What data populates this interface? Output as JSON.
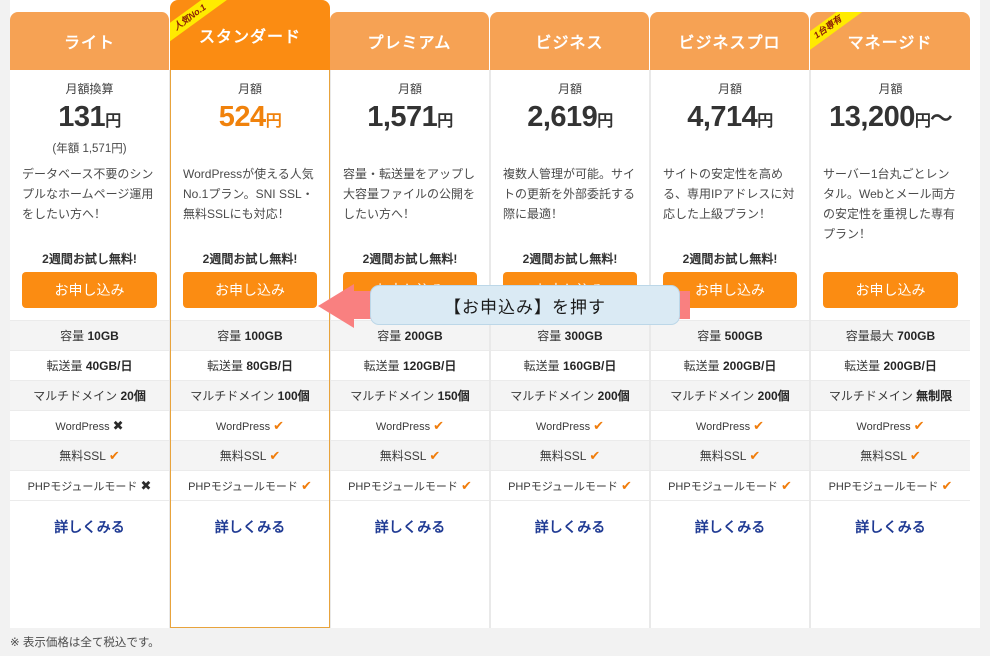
{
  "footnote": "※ 表示価格は全て税込です。",
  "annotation": {
    "text": "【お申込み】を押す",
    "arrow_color": "#f98080",
    "pill_color": "#daeaf4"
  },
  "labels": {
    "detail_link": "詳しくみる",
    "apply_button": "お申し込み",
    "trial": "2週間お試し無料!"
  },
  "colors": {
    "tab": "#f6a254",
    "tab_featured": "#fb8c12",
    "ribbon": "#ffeb00",
    "ribbon_text": "#8b1d06",
    "price_featured": "#f0820c",
    "button": "#fb8c12",
    "detail_link": "#1f3a93",
    "check": "#f07c0a",
    "cross": "#2b2b2b"
  },
  "plans": [
    {
      "name": "ライト",
      "badge": null,
      "featured": false,
      "price_label": "月額換算",
      "price_value": "131",
      "price_unit": "円",
      "price_suffix": "",
      "price_sub": "(年額 1,571円)",
      "description": "データベース不要のシンプルなホームページ運用をしたい方へ！",
      "trial": "2週間お試し無料!",
      "apply": "お申し込み",
      "specs": [
        {
          "label": "容量",
          "value": "10GB",
          "mark": null
        },
        {
          "label": "転送量",
          "value": "40GB/日",
          "mark": null
        },
        {
          "label": "マルチドメイン",
          "value": "20個",
          "mark": null
        },
        {
          "label": "WordPress",
          "value": "",
          "mark": "no"
        },
        {
          "label": "無料SSL",
          "value": "",
          "mark": "ok"
        },
        {
          "label": "PHPモジュールモード",
          "value": "",
          "mark": "no"
        }
      ],
      "detail": "詳しくみる"
    },
    {
      "name": "スタンダード",
      "badge": "人気No.1",
      "featured": true,
      "price_label": "月額",
      "price_value": "524",
      "price_unit": "円",
      "price_suffix": "",
      "price_sub": "",
      "description": "WordPressが使える人気No.1プラン。SNI SSL・無料SSLにも対応！",
      "trial": "2週間お試し無料!",
      "apply": "お申し込み",
      "specs": [
        {
          "label": "容量",
          "value": "100GB",
          "mark": null
        },
        {
          "label": "転送量",
          "value": "80GB/日",
          "mark": null
        },
        {
          "label": "マルチドメイン",
          "value": "100個",
          "mark": null
        },
        {
          "label": "WordPress",
          "value": "",
          "mark": "ok"
        },
        {
          "label": "無料SSL",
          "value": "",
          "mark": "ok"
        },
        {
          "label": "PHPモジュールモード",
          "value": "",
          "mark": "ok"
        }
      ],
      "detail": "詳しくみる"
    },
    {
      "name": "プレミアム",
      "badge": null,
      "featured": false,
      "price_label": "月額",
      "price_value": "1,571",
      "price_unit": "円",
      "price_suffix": "",
      "price_sub": "",
      "description": "容量・転送量をアップし大容量ファイルの公開をしたい方へ！",
      "trial": "2週間お試し無料!",
      "apply": "お申し込み",
      "specs": [
        {
          "label": "容量",
          "value": "200GB",
          "mark": null
        },
        {
          "label": "転送量",
          "value": "120GB/日",
          "mark": null
        },
        {
          "label": "マルチドメイン",
          "value": "150個",
          "mark": null
        },
        {
          "label": "WordPress",
          "value": "",
          "mark": "ok"
        },
        {
          "label": "無料SSL",
          "value": "",
          "mark": "ok"
        },
        {
          "label": "PHPモジュールモード",
          "value": "",
          "mark": "ok"
        }
      ],
      "detail": "詳しくみる"
    },
    {
      "name": "ビジネス",
      "badge": null,
      "featured": false,
      "price_label": "月額",
      "price_value": "2,619",
      "price_unit": "円",
      "price_suffix": "",
      "price_sub": "",
      "description": "複数人管理が可能。サイトの更新を外部委託する際に最適！",
      "trial": "2週間お試し無料!",
      "apply": "お申し込み",
      "specs": [
        {
          "label": "容量",
          "value": "300GB",
          "mark": null
        },
        {
          "label": "転送量",
          "value": "160GB/日",
          "mark": null
        },
        {
          "label": "マルチドメイン",
          "value": "200個",
          "mark": null
        },
        {
          "label": "WordPress",
          "value": "",
          "mark": "ok"
        },
        {
          "label": "無料SSL",
          "value": "",
          "mark": "ok"
        },
        {
          "label": "PHPモジュールモード",
          "value": "",
          "mark": "ok"
        }
      ],
      "detail": "詳しくみる"
    },
    {
      "name": "ビジネスプロ",
      "badge": null,
      "featured": false,
      "price_label": "月額",
      "price_value": "4,714",
      "price_unit": "円",
      "price_suffix": "",
      "price_sub": "",
      "description": "サイトの安定性を高める、専用IPアドレスに対応した上級プラン！",
      "trial": "2週間お試し無料!",
      "apply": "お申し込み",
      "specs": [
        {
          "label": "容量",
          "value": "500GB",
          "mark": null
        },
        {
          "label": "転送量",
          "value": "200GB/日",
          "mark": null
        },
        {
          "label": "マルチドメイン",
          "value": "200個",
          "mark": null
        },
        {
          "label": "WordPress",
          "value": "",
          "mark": "ok"
        },
        {
          "label": "無料SSL",
          "value": "",
          "mark": "ok"
        },
        {
          "label": "PHPモジュールモード",
          "value": "",
          "mark": "ok"
        }
      ],
      "detail": "詳しくみる"
    },
    {
      "name": "マネージド",
      "badge": "1台専有",
      "featured": false,
      "price_label": "月額",
      "price_value": "13,200",
      "price_unit": "円",
      "price_suffix": "〜",
      "price_sub": "",
      "description": "サーバー1台丸ごとレンタル。Webとメール両方の安定性を重視した専有プラン！",
      "trial": "",
      "apply": "お申し込み",
      "specs": [
        {
          "label": "容量最大",
          "value": "700GB",
          "mark": null
        },
        {
          "label": "転送量",
          "value": "200GB/日",
          "mark": null
        },
        {
          "label": "マルチドメイン",
          "value": "無制限",
          "mark": null
        },
        {
          "label": "WordPress",
          "value": "",
          "mark": "ok"
        },
        {
          "label": "無料SSL",
          "value": "",
          "mark": "ok"
        },
        {
          "label": "PHPモジュールモード",
          "value": "",
          "mark": "ok"
        }
      ],
      "detail": "詳しくみる"
    }
  ]
}
